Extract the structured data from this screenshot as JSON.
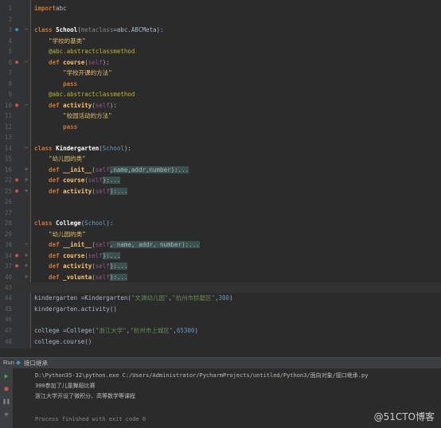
{
  "editor": {
    "lines": [
      {
        "n": "1",
        "parts": [
          [
            "kw",
            "import"
          ],
          [
            "",
            "abc"
          ]
        ]
      },
      {
        "n": "2",
        "parts": []
      },
      {
        "n": "3",
        "parts": [
          [
            "kw",
            "class"
          ],
          [
            "cls",
            " School"
          ],
          [
            "",
            "("
          ],
          [
            "dim",
            "metaclass"
          ],
          [
            "",
            "=abc.ABCMeta):"
          ]
        ]
      },
      {
        "n": "4",
        "parts": [
          [
            "str",
            "    \"学校的基类\""
          ]
        ]
      },
      {
        "n": "5",
        "parts": [
          [
            "deco",
            "    @abc.abstractclassmethod"
          ]
        ]
      },
      {
        "n": "6",
        "parts": [
          [
            "kw",
            "    def"
          ],
          [
            "fn",
            " course"
          ],
          [
            "",
            "("
          ],
          [
            "self",
            "self"
          ],
          [
            "",
            "):"
          ]
        ]
      },
      {
        "n": "7",
        "parts": [
          [
            "str",
            "        \"学校开课的方法\""
          ]
        ]
      },
      {
        "n": "8",
        "parts": [
          [
            "kw",
            "        pass"
          ]
        ]
      },
      {
        "n": "9",
        "parts": [
          [
            "deco",
            "    @abc.abstractclassmethod"
          ]
        ]
      },
      {
        "n": "10",
        "parts": [
          [
            "kw",
            "    def"
          ],
          [
            "fn",
            " activity"
          ],
          [
            "",
            "("
          ],
          [
            "self",
            "self"
          ],
          [
            "",
            "):"
          ]
        ]
      },
      {
        "n": "11",
        "parts": [
          [
            "str",
            "        \"校园活动的方法\""
          ]
        ]
      },
      {
        "n": "12",
        "parts": [
          [
            "kw",
            "        pass"
          ]
        ]
      },
      {
        "n": "13",
        "parts": []
      },
      {
        "n": "14",
        "parts": [
          [
            "kw",
            "class"
          ],
          [
            "cls",
            " Kindergarten"
          ],
          [
            "",
            "("
          ],
          [
            "num",
            "School"
          ],
          [
            "",
            "):"
          ]
        ]
      },
      {
        "n": "15",
        "parts": [
          [
            "str",
            "    \"幼儿园的类\""
          ]
        ]
      },
      {
        "n": "16",
        "parts": [
          [
            "kw",
            "    def"
          ],
          [
            "fn",
            " __init__"
          ],
          [
            "",
            "("
          ],
          [
            "self",
            "self"
          ],
          [
            "",
            ",name,addr,number):..."
          ]
        ]
      },
      {
        "n": "22",
        "parts": [
          [
            "kw",
            "    def"
          ],
          [
            "fn",
            " course"
          ],
          [
            "",
            "("
          ],
          [
            "self",
            "self"
          ],
          [
            "",
            "):..."
          ]
        ]
      },
      {
        "n": "25",
        "parts": [
          [
            "kw",
            "    def"
          ],
          [
            "fn",
            " activity"
          ],
          [
            "",
            "("
          ],
          [
            "self",
            "self"
          ],
          [
            "",
            "):..."
          ]
        ]
      },
      {
        "n": "26",
        "parts": []
      },
      {
        "n": "27",
        "parts": []
      },
      {
        "n": "28",
        "parts": [
          [
            "kw",
            "class"
          ],
          [
            "cls",
            " College"
          ],
          [
            "",
            "("
          ],
          [
            "num",
            "School"
          ],
          [
            "",
            "):"
          ]
        ]
      },
      {
        "n": "29",
        "parts": [
          [
            "str",
            "    \"幼儿园的类\""
          ]
        ]
      },
      {
        "n": "30",
        "parts": [
          [
            "kw",
            "    def"
          ],
          [
            "fn",
            " __init__"
          ],
          [
            "",
            "("
          ],
          [
            "self",
            "self"
          ],
          [
            "",
            ", name, addr, number):..."
          ]
        ]
      },
      {
        "n": "34",
        "parts": [
          [
            "kw",
            "    def"
          ],
          [
            "fn",
            " course"
          ],
          [
            "",
            "("
          ],
          [
            "self",
            "self"
          ],
          [
            "",
            "):..."
          ]
        ]
      },
      {
        "n": "37",
        "parts": [
          [
            "kw",
            "    def"
          ],
          [
            "fn",
            " activity"
          ],
          [
            "",
            "("
          ],
          [
            "self",
            "self"
          ],
          [
            "",
            "):..."
          ]
        ]
      },
      {
        "n": "40",
        "parts": [
          [
            "kw",
            "    def"
          ],
          [
            "fn",
            " _volunta"
          ],
          [
            "",
            "("
          ],
          [
            "self",
            "self"
          ],
          [
            "",
            "):..."
          ]
        ]
      },
      {
        "n": "43",
        "parts": []
      },
      {
        "n": "44",
        "parts": [
          [
            "",
            "kindergarten ="
          ],
          [
            "",
            "Kindergarten("
          ],
          [
            "strc",
            "\"文渊幼儿园\""
          ],
          [
            "",
            ","
          ],
          [
            "strc",
            "\"杭州市拱墅区\""
          ],
          [
            "",
            ","
          ],
          [
            "num",
            "300"
          ],
          [
            "",
            ")"
          ]
        ]
      },
      {
        "n": "45",
        "parts": [
          [
            "",
            "kindergarten.activity()"
          ]
        ]
      },
      {
        "n": "46",
        "parts": []
      },
      {
        "n": "47",
        "parts": [
          [
            "",
            "college ="
          ],
          [
            "",
            "College("
          ],
          [
            "strc",
            "\"浙江大学\""
          ],
          [
            "",
            ","
          ],
          [
            "strc",
            "\"杭州市上城区\""
          ],
          [
            "",
            ","
          ],
          [
            "num",
            "65300"
          ],
          [
            "",
            ")"
          ]
        ]
      },
      {
        "n": "48",
        "parts": [
          [
            "",
            "college.course()"
          ]
        ]
      }
    ]
  },
  "run": {
    "label": "Run",
    "tab": "接口继承",
    "output": [
      "D:\\Python35-32\\python.exe C:/Users/Administrator/PycharmProjects/untitled/Python3/面向对象/接口继承.py",
      "300参加了儿童舞蹈比赛",
      "浙江大学开设了微积分、高等数学等课程",
      "",
      "Process finished with exit code 0"
    ]
  },
  "watermark": "@51CTO博客",
  "colors": {
    "bg": "#2b2b2b",
    "gutter": "#313335",
    "keyword": "#cc7832",
    "string": "#e8bf6a"
  }
}
